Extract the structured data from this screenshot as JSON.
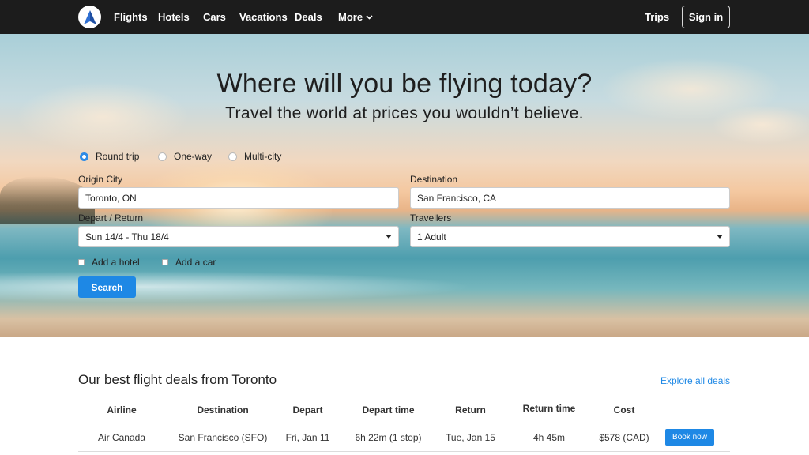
{
  "nav": {
    "links": [
      "Flights",
      "Hotels",
      "Cars",
      "Vacations",
      "Deals"
    ],
    "more_label": "More",
    "trips_label": "Trips",
    "signin_label": "Sign in"
  },
  "hero": {
    "title": "Where will you be flying today?",
    "subtitle": "Travel the world at prices you wouldn’t believe."
  },
  "search_form": {
    "trip_types": [
      "Round trip",
      "One-way",
      "Multi-city"
    ],
    "selected_trip_type": "Round trip",
    "origin": {
      "label": "Origin City",
      "value": "Toronto, ON"
    },
    "destination": {
      "label": "Destination",
      "value": "San Francisco, CA"
    },
    "dates": {
      "label": "Depart / Return",
      "value": "Sun 14/4 - Thu 18/4"
    },
    "travellers": {
      "label": "Travellers",
      "value": "1 Adult"
    },
    "add_hotel_label": "Add a hotel",
    "add_car_label": "Add a car",
    "search_label": "Search"
  },
  "deals": {
    "title": "Our best flight deals from Toronto",
    "explore_label": "Explore all deals",
    "columns": [
      "Airline",
      "Destination",
      "Depart",
      "Depart time",
      "Return",
      "Return time",
      "Cost",
      ""
    ],
    "rows": [
      {
        "airline": "Air Canada",
        "destination": "San Francisco (SFO)",
        "depart": "Fri, Jan 11",
        "depart_time": "6h 22m (1 stop)",
        "return": "Tue, Jan 15",
        "return_time": "4h 45m",
        "cost": "$578 (CAD)",
        "action_label": "Book now"
      }
    ]
  },
  "colors": {
    "navbar_bg": "#1c1c1c",
    "accent": "#1e88e5",
    "logo_triangle": "#1e4fa3"
  },
  "icons": {
    "logo": "triangle-logo-icon",
    "more": "chevron-down-icon",
    "select": "caret-down-icon"
  }
}
